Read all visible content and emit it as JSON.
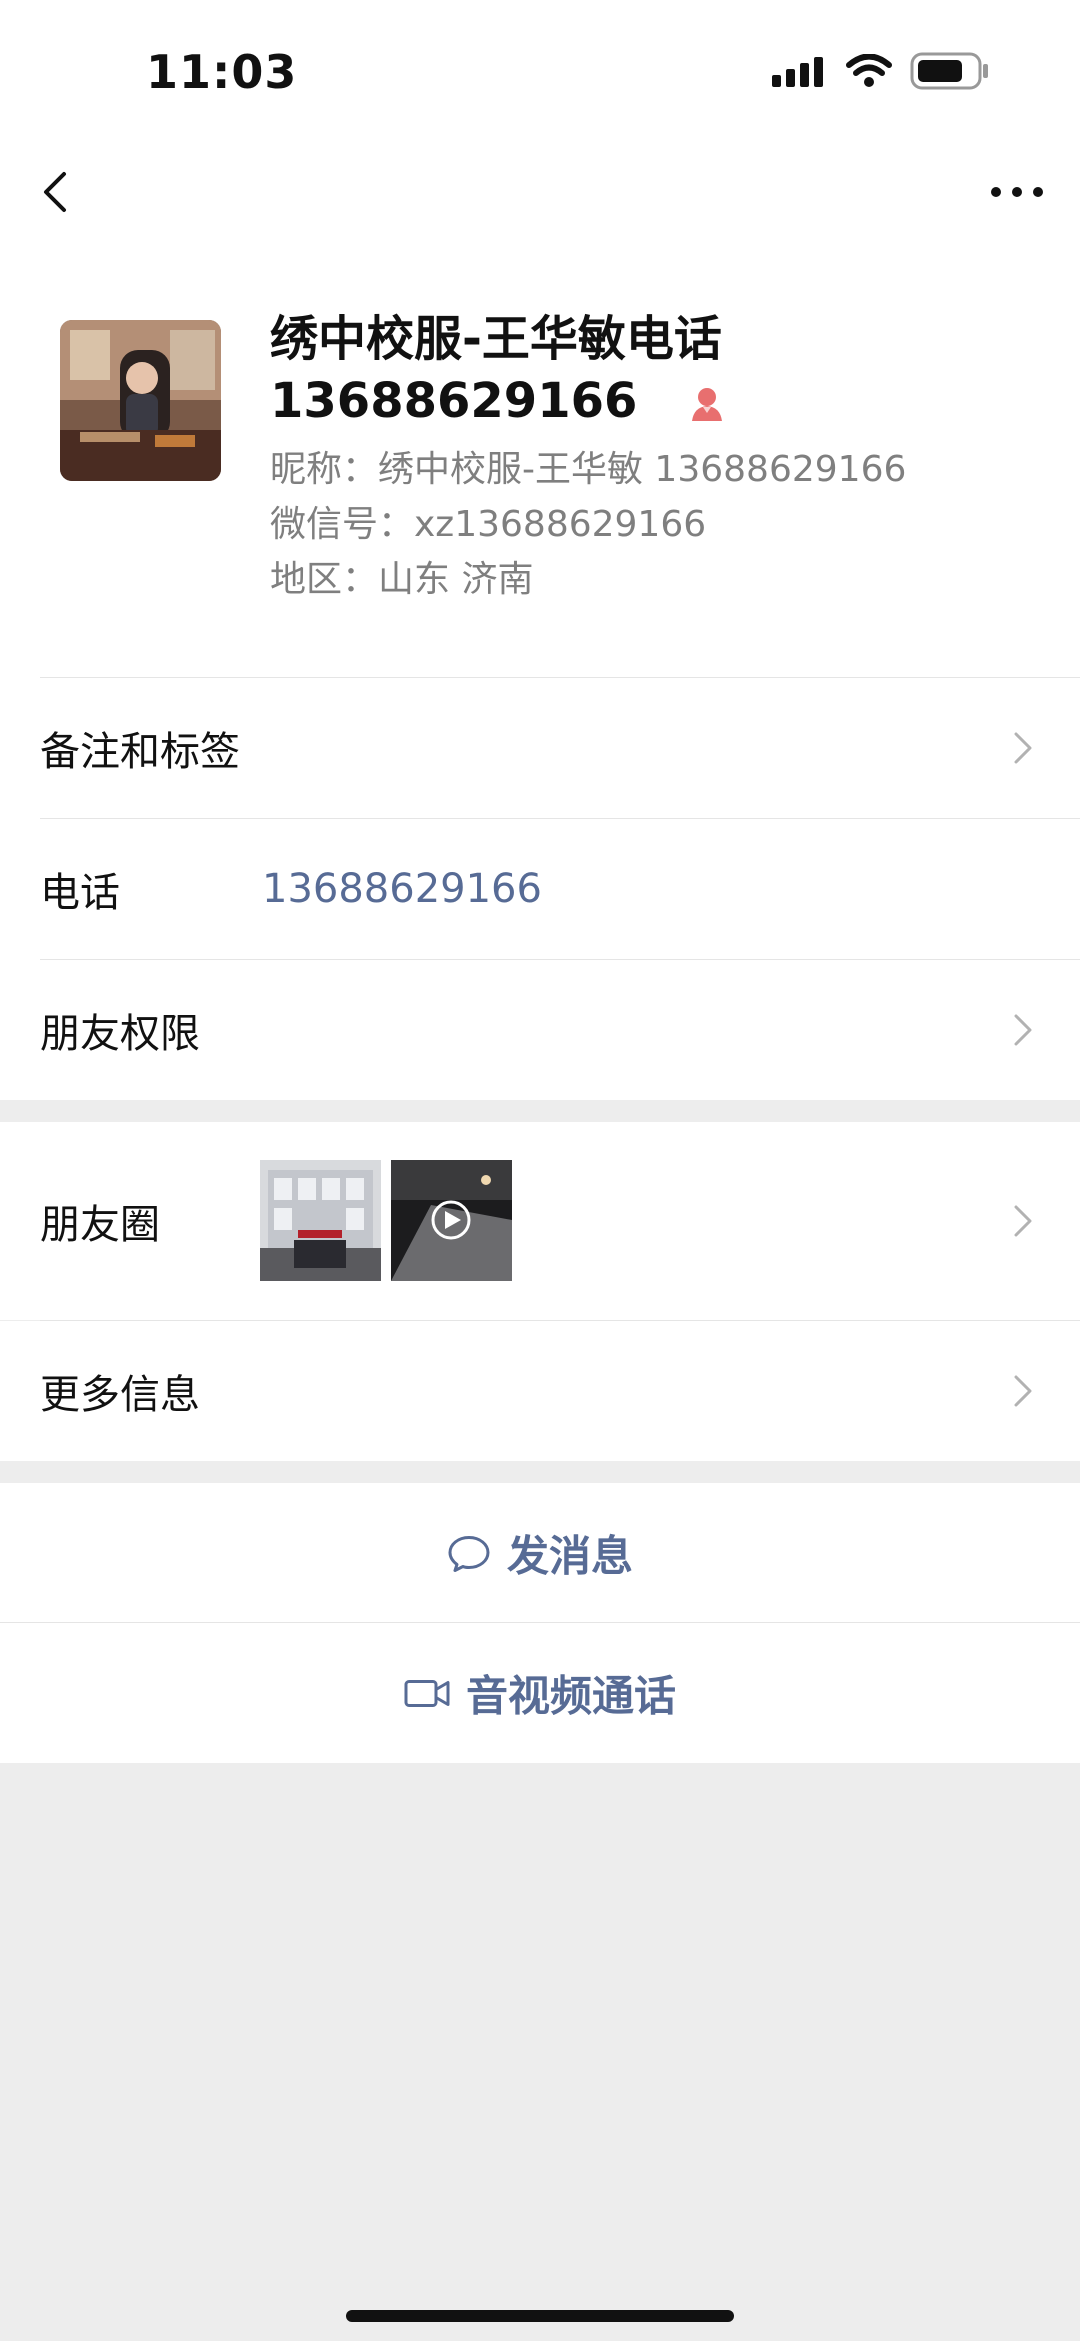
{
  "status_bar": {
    "time": "11:03",
    "battery_icon": "battery-icon",
    "wifi_icon": "wifi-icon",
    "signal_icon": "signal-icon"
  },
  "nav": {
    "back_icon": "chevron-left-icon",
    "more_icon": "more-dots-icon"
  },
  "profile": {
    "name": "绣中校服-王华敏电话",
    "name_line2": "13688629166",
    "gender_icon": "female-icon",
    "nickname": "昵称：绣中校服-王华敏 13688629166",
    "wechat_id": "微信号：xz13688629166",
    "region": "地区：山东 济南"
  },
  "rows": {
    "remarks": "备注和标签",
    "phone_label": "电话",
    "phone_value": "13688629166",
    "friend_permissions": "朋友权限",
    "moments": "朋友圈",
    "more_info": "更多信息"
  },
  "actions": {
    "message": "发消息",
    "message_icon": "chat-bubble-icon",
    "video_call": "音视频通话",
    "video_icon": "video-camera-icon"
  },
  "colors": {
    "link": "#576b95",
    "background": "#ededed",
    "female": "#e86f6f"
  }
}
